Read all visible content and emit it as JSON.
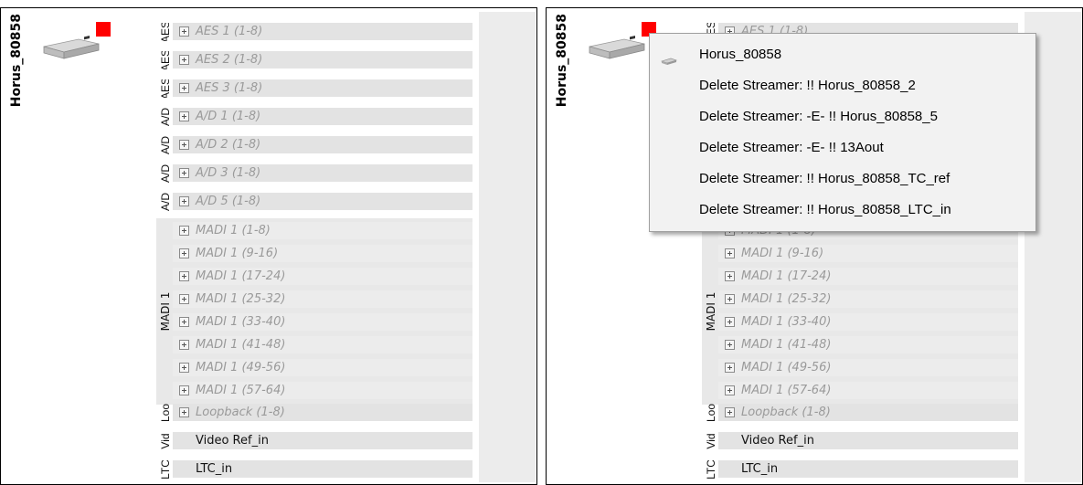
{
  "device": {
    "name": "Horus_80858",
    "status_color": "#ff0000"
  },
  "channels": {
    "aes": [
      {
        "side": "AES",
        "label": "AES 1 (1-8)"
      },
      {
        "side": "AES",
        "label": "AES 2 (1-8)"
      },
      {
        "side": "AES",
        "label": "AES 3 (1-8)"
      }
    ],
    "ad": [
      {
        "side": "A/D",
        "label": "A/D 1 (1-8)"
      },
      {
        "side": "A/D",
        "label": "A/D 2 (1-8)"
      },
      {
        "side": "A/D",
        "label": "A/D 3 (1-8)"
      },
      {
        "side": "A/D",
        "label": "A/D 5 (1-8)"
      }
    ],
    "madi_group": "MADI 1",
    "madi": [
      "MADI 1 (1-8)",
      "MADI 1 (9-16)",
      "MADI 1 (17-24)",
      "MADI 1 (25-32)",
      "MADI 1 (33-40)",
      "MADI 1 (41-48)",
      "MADI 1 (49-56)",
      "MADI 1 (57-64)"
    ],
    "loopback": {
      "side": "Loo",
      "label": "Loopback (1-8)"
    },
    "video": {
      "side": "Vid",
      "label": "Video Ref_in"
    },
    "ltc": {
      "side": "LTC",
      "label": "LTC_in"
    }
  },
  "context_menu": {
    "items": [
      "Horus_80858",
      "Delete Streamer: !! Horus_80858_2",
      "Delete Streamer: -E- !! Horus_80858_5",
      "Delete Streamer: -E- !! 13Aout",
      "Delete Streamer: !! Horus_80858_TC_ref",
      "Delete Streamer: !! Horus_80858_LTC_in"
    ]
  },
  "icons": [
    "device-chassis-icon",
    "expand-plus-icon",
    "streamer-device-icon"
  ]
}
